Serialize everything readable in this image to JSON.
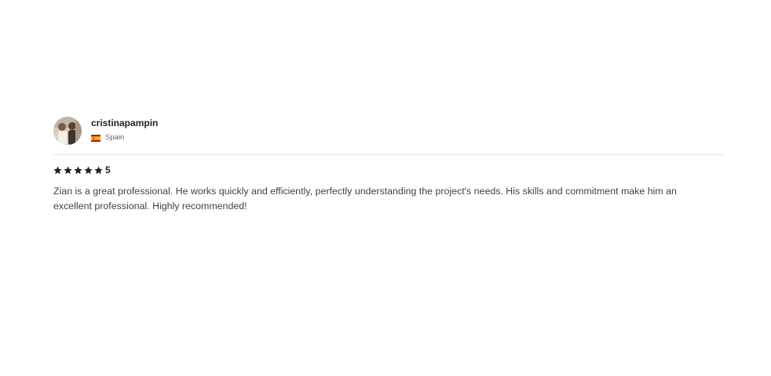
{
  "review": {
    "reviewer": {
      "username": "cristinapampin",
      "country": "Spain",
      "flag_icon": "spain-flag-icon"
    },
    "rating": {
      "stars": 5,
      "max_stars": 5,
      "score_label": "5",
      "star_icon": "star-icon",
      "star_color": "#222325"
    },
    "text": "Zian is a great professional. He works quickly and efficiently, perfectly understanding the project's needs. His skills and commitment make him an excellent professional. Highly recommended!"
  },
  "colors": {
    "text_primary": "#222325",
    "text_body": "#404145",
    "text_muted": "#62646a",
    "divider": "#e4e5e7"
  }
}
